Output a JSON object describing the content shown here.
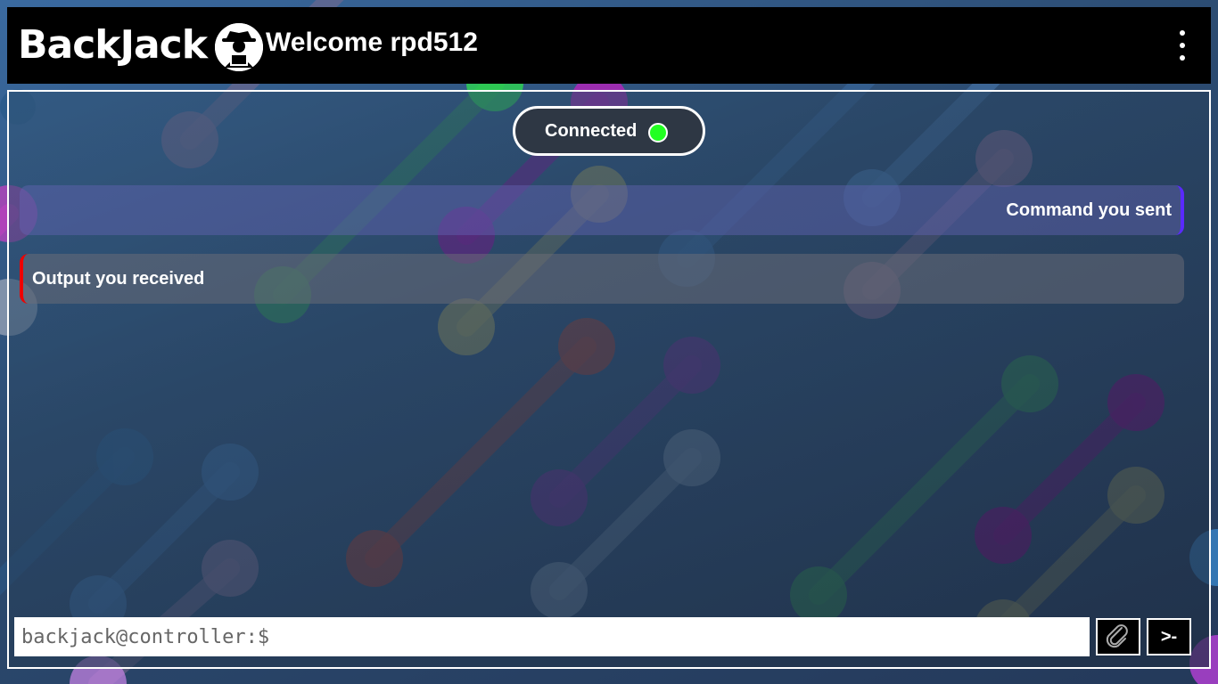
{
  "app": {
    "title": "BackJack",
    "welcome": "Welcome rpd512"
  },
  "header": {
    "logo_icon": "spy-hacker-icon",
    "menu_icon": "vertical-dots-icon"
  },
  "status": {
    "label": "Connected",
    "indicator_color": "#22ff22"
  },
  "messages": [
    {
      "type": "sent",
      "text": "Command you sent",
      "accent": "#5a2aff"
    },
    {
      "type": "received",
      "text": "Output you received",
      "accent": "#ee0000"
    }
  ],
  "command_bar": {
    "placeholder": "backjack@controller:$",
    "value": "",
    "attach_icon": "paperclip-icon",
    "send_label": ">-"
  },
  "colors": {
    "header_bg": "#000000",
    "accent_sent": "#5a2aff",
    "accent_received": "#ee0000",
    "connected": "#22ff22"
  }
}
